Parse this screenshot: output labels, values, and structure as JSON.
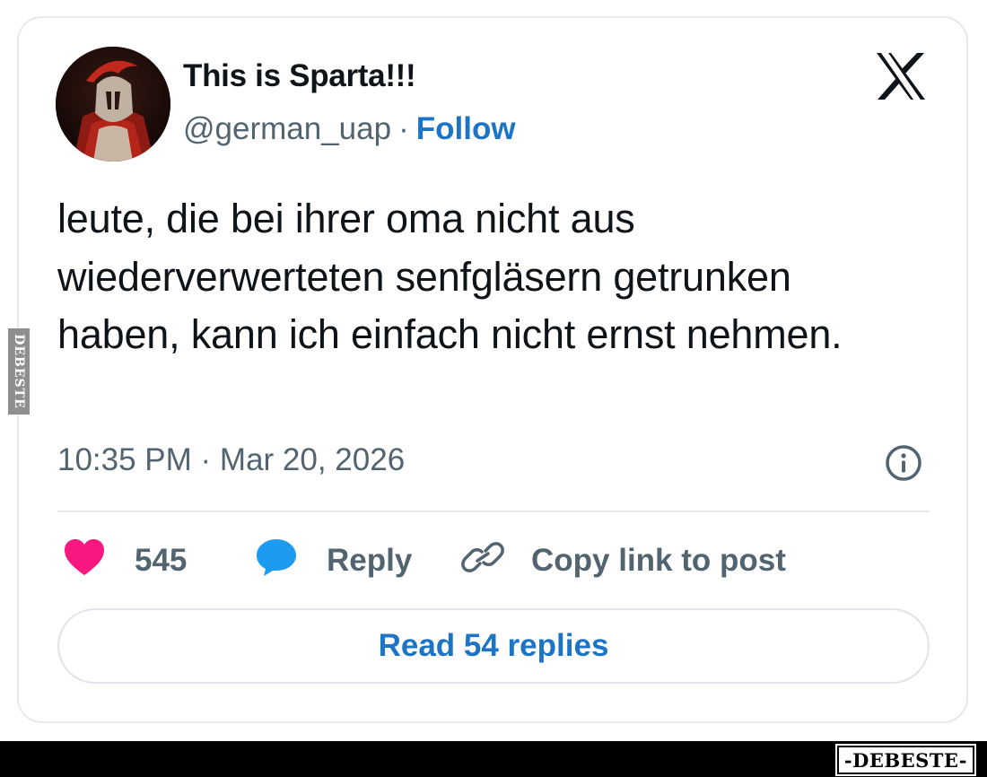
{
  "tweet": {
    "display_name": "This is Sparta!!!",
    "handle": "@german_uap",
    "separator": "·",
    "follow_label": "Follow",
    "text": "leute, die bei ihrer oma nicht aus wiederverwerteten senfgläsern getrunken haben, kann ich einfach nicht ernst nehmen.",
    "timestamp": "10:35 PM · Mar 20, 2026",
    "likes": "545",
    "reply_label": "Reply",
    "copy_link_label": "Copy link to post",
    "read_replies_label": "Read 54 replies"
  },
  "icons": {
    "platform": "x-logo-icon",
    "info": "info-icon",
    "like": "heart-icon",
    "reply": "speech-bubble-icon",
    "copy": "link-icon"
  },
  "colors": {
    "link_blue": "#1d74c4",
    "like_pink": "#f91880",
    "reply_blue": "#1d9bf0",
    "muted_gray": "#536471"
  },
  "watermark": {
    "side": "DEBESTE",
    "brand": "-DEBESTE-"
  }
}
